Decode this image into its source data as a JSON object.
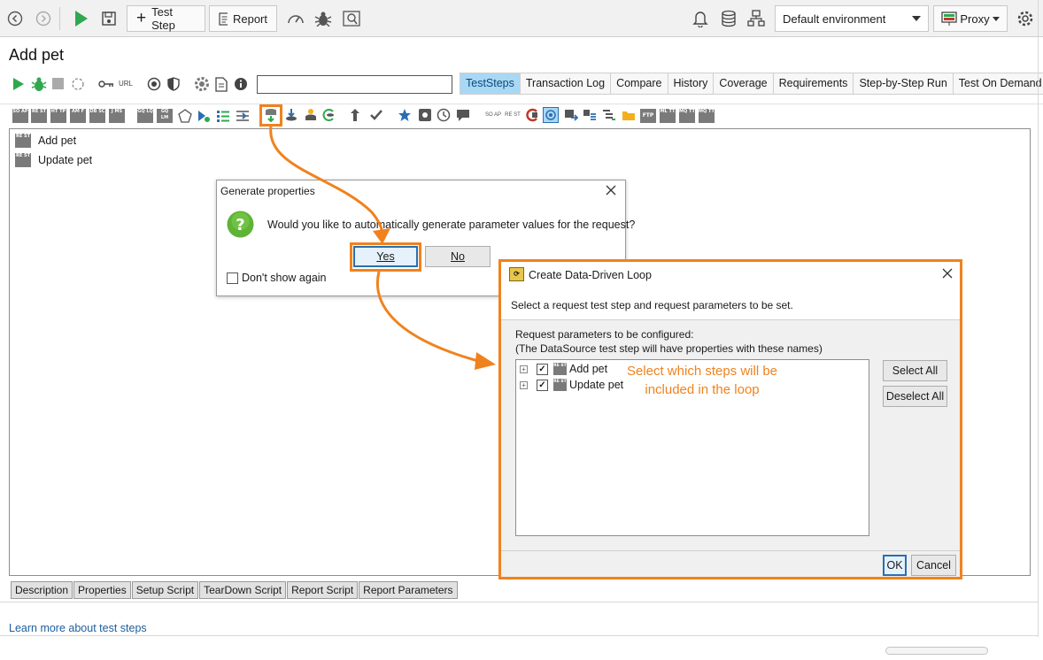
{
  "toolbar": {
    "test_step_label": "Test Step",
    "report_label": "Report",
    "environment": "Default environment",
    "proxy_label": "Proxy"
  },
  "page": {
    "title": "Add pet",
    "url_icon_label": "URL",
    "search_value": ""
  },
  "tabs": [
    "TestSteps",
    "Transaction Log",
    "Compare",
    "History",
    "Coverage",
    "Requirements",
    "Step-by-Step Run",
    "Test On Demand"
  ],
  "icon_toolbar": {
    "glyphs": [
      "SO AP",
      "RE ST",
      "HT TP",
      "AM F",
      "DB SC",
      "J MS",
      "GQ LQ",
      "GQ LM",
      "ML TT",
      "MQ TT",
      "MQ TT",
      "SO AP",
      "RE ST",
      "FTP"
    ]
  },
  "steps": [
    {
      "label": "Add pet",
      "icon": "RE ST"
    },
    {
      "label": "Update pet",
      "icon": "RE ST"
    }
  ],
  "bottom_tabs": [
    "Description",
    "Properties",
    "Setup Script",
    "TearDown Script",
    "Report Script",
    "Report Parameters"
  ],
  "learn_more_link": "Learn more about test steps",
  "generate_dialog": {
    "title": "Generate properties",
    "message": "Would you like to automatically generate parameter values for the request?",
    "yes_label": "Yes",
    "no_label": "No",
    "dont_show_label": "Don't show again"
  },
  "loop_dialog": {
    "title": "Create Data-Driven Loop",
    "instruction": "Select a request test step and request parameters to be set.",
    "params_label": "Request parameters to be configured:",
    "params_note": "(The DataSource test step will have properties with these names)",
    "tree_items": [
      {
        "label": "Add pet",
        "checked": true
      },
      {
        "label": "Update pet",
        "checked": true
      }
    ],
    "select_all_label": "Select All",
    "deselect_all_label": "Deselect All",
    "ok_label": "OK",
    "cancel_label": "Cancel"
  },
  "annotation": {
    "line1": "Select which steps will be",
    "line2": "included in the loop"
  },
  "colors": {
    "accent_orange": "#f0821e",
    "active_tab": "#a9d8f5",
    "run_green": "#2fa84f",
    "link_blue": "#1b5e9e"
  }
}
